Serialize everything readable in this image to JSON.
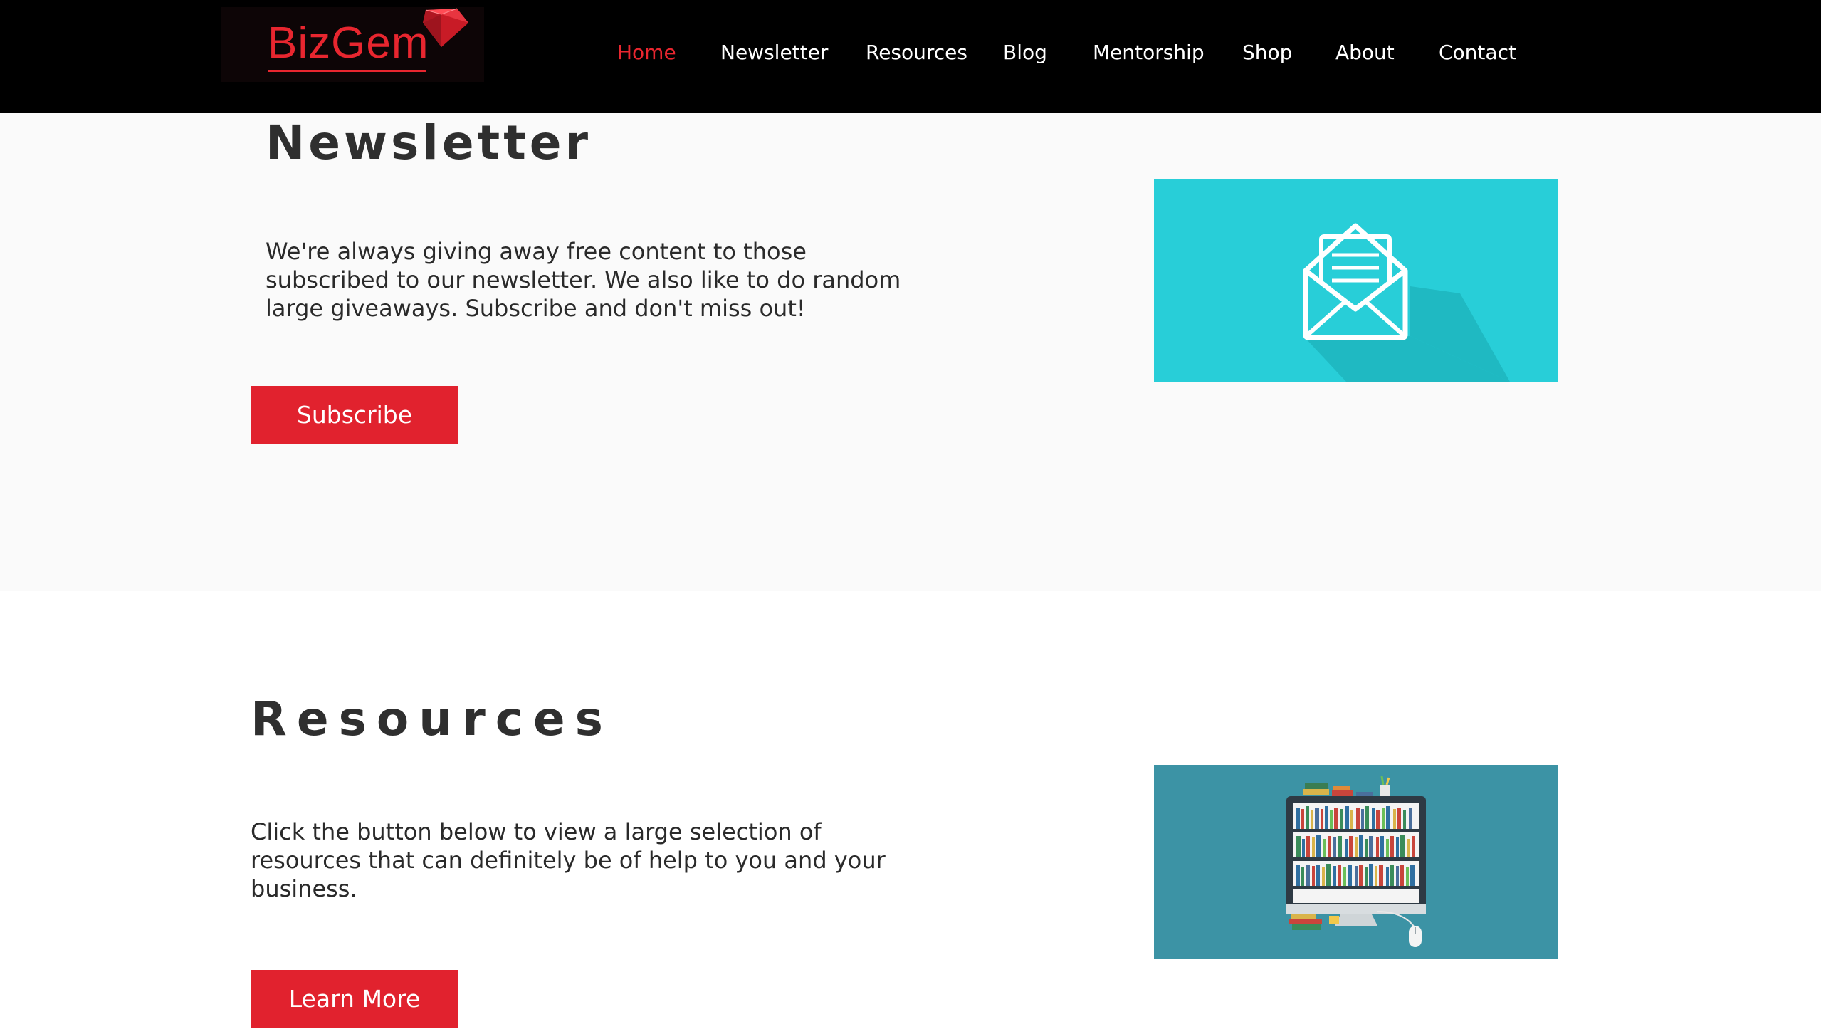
{
  "header": {
    "logo_text": "BizGem",
    "nav": {
      "home": "Home",
      "newsletter": "Newsletter",
      "resources": "Resources",
      "blog": "Blog",
      "mentorship": "Mentorship",
      "shop": "Shop",
      "about": "About",
      "contact": "Contact"
    },
    "active_item": "Home"
  },
  "newsletter": {
    "title": "Newsletter",
    "text": "We're always giving away free content to those subscribed to our newsletter. We also like to do random large giveaways. Subscribe and don't miss out!",
    "button_label": "Subscribe",
    "image_icon": "envelope-icon"
  },
  "resources": {
    "title": "Resources",
    "text": "Click the button below to view a large selection of resources that can definitely be of help to you and your business.",
    "button_label": "Learn More",
    "image_icon": "bookshelf-monitor-icon"
  },
  "colors": {
    "accent": "#e1222e",
    "header_bg": "#000000",
    "newsletter_image_bg": "#28ced8",
    "resources_image_bg": "#3c93a5",
    "section_bg": "#fafafa"
  }
}
